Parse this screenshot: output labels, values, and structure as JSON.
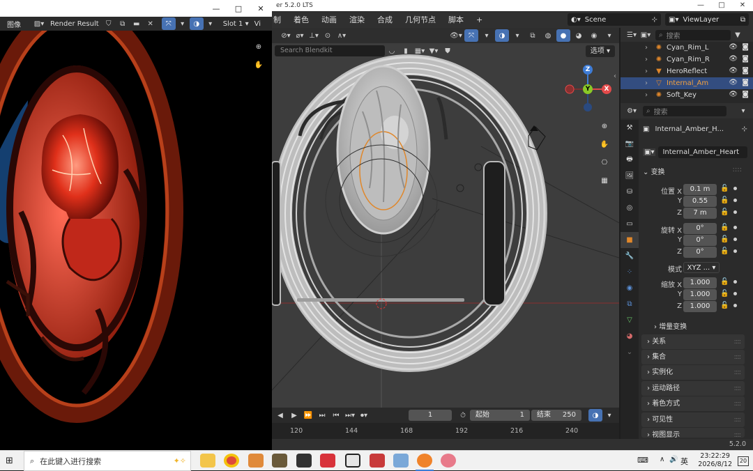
{
  "blender": {
    "title_fragment": "er 5.2.0 LTS",
    "menu": [
      "制",
      "着色",
      "动画",
      "渲染",
      "合成",
      "几何节点",
      "脚本",
      "+"
    ],
    "scene": "Scene",
    "view_layer": "ViewLayer",
    "window_controls": [
      "—",
      "□",
      "✕"
    ]
  },
  "viewport": {
    "search_placeholder": "Search Blendkit",
    "options_label": "选项",
    "gizmo": {
      "z": "Z",
      "y": "Y",
      "x": "X"
    }
  },
  "outliner": {
    "search_placeholder": "搜索",
    "items": [
      {
        "name": "Cyan_Rim_L",
        "selected": false
      },
      {
        "name": "Cyan_Rim_R",
        "selected": false
      },
      {
        "name": "HeroReflect",
        "selected": false
      },
      {
        "name": "Internal_Am",
        "selected": true
      },
      {
        "name": "Soft_Key",
        "selected": false
      }
    ]
  },
  "properties": {
    "search_placeholder": "搜索",
    "object_name": "Internal_Amber_H...",
    "datablock_name": "Internal_Amber_Heart",
    "transform_header": "变换",
    "location": {
      "label": "位置 X",
      "x": "0.1 m",
      "y_label": "Y",
      "y": "0.55",
      "z_label": "Z",
      "z": "7 m"
    },
    "rotation": {
      "label": "旋转 X",
      "x": "0°",
      "y_label": "Y",
      "y": "0°",
      "z_label": "Z",
      "z": "0°"
    },
    "mode": {
      "label": "模式",
      "value": "XYZ ..."
    },
    "scale": {
      "label": "缩放 X",
      "x": "1.000",
      "y_label": "Y",
      "y": "1.000",
      "z_label": "Z",
      "z": "1.000"
    },
    "delta_transform": "增量变换",
    "panels": [
      "关系",
      "集合",
      "实例化",
      "运动路径",
      "着色方式",
      "可见性",
      "视图显示"
    ]
  },
  "timeline": {
    "current_frame": "1",
    "start_label": "起始",
    "start": "1",
    "end_label": "结束",
    "end": "250",
    "ticks": [
      "120",
      "144",
      "168",
      "192",
      "216",
      "240"
    ]
  },
  "status": {
    "version": "5.2.0"
  },
  "render_window": {
    "menu_label": "图像",
    "image_name": "Render Result",
    "slot": "Slot 1",
    "view_fragment": "Vi",
    "window_controls": [
      "—",
      "□",
      "✕"
    ]
  },
  "taskbar": {
    "search_placeholder": "在此键入进行搜索",
    "ime": "英",
    "time": "23:22:29",
    "date": "2026/8/12",
    "notification_count": "20"
  },
  "colors": {
    "accent": "#4772b3",
    "selection": "#334d80",
    "gizmo_x": "#e34a4a",
    "gizmo_y": "#8ac926",
    "gizmo_z": "#3e7cd6",
    "selected_outline": "#e0872a"
  }
}
